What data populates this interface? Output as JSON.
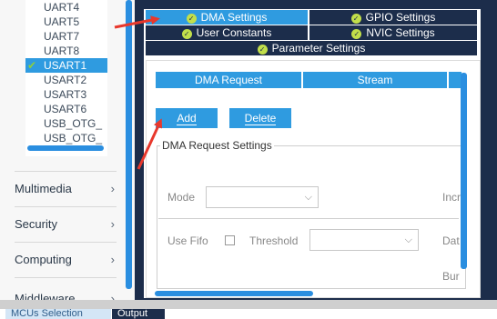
{
  "sidebar": {
    "peripherals": [
      {
        "label": "UART4",
        "selected": false
      },
      {
        "label": "UART5",
        "selected": false
      },
      {
        "label": "UART7",
        "selected": false
      },
      {
        "label": "UART8",
        "selected": false
      },
      {
        "label": "USART1",
        "selected": true
      },
      {
        "label": "USART2",
        "selected": false
      },
      {
        "label": "USART3",
        "selected": false
      },
      {
        "label": "USART6",
        "selected": false
      },
      {
        "label": "USB_OTG_",
        "selected": false
      },
      {
        "label": "USB_OTG_",
        "selected": false
      }
    ],
    "categories": [
      {
        "label": "Multimedia"
      },
      {
        "label": "Security"
      },
      {
        "label": "Computing"
      },
      {
        "label": "Middleware"
      }
    ]
  },
  "tabs": {
    "dma": "DMA Settings",
    "gpio": "GPIO Settings",
    "user_constants": "User Constants",
    "nvic": "NVIC Settings",
    "parameter": "Parameter Settings"
  },
  "dma_table": {
    "columns": [
      "DMA Request",
      "Stream"
    ]
  },
  "buttons": {
    "add": "Add",
    "delete": "Delete"
  },
  "request_settings": {
    "title": "DMA Request Settings",
    "mode_label": "Mode",
    "mode_value": "",
    "incr_label": "Incr",
    "use_fifo_label": "Use Fifo",
    "threshold_label": "Threshold",
    "threshold_value": "",
    "data_label": "Dat",
    "burst_label": "Bur"
  },
  "bottom_tabs": {
    "mcus_selection": "MCUs Selection",
    "output": "Output"
  },
  "colors": {
    "accent": "#2f9be0",
    "navy": "#1c2d4b",
    "ok_badge": "#c2df4a",
    "annotation": "#e8382c"
  }
}
